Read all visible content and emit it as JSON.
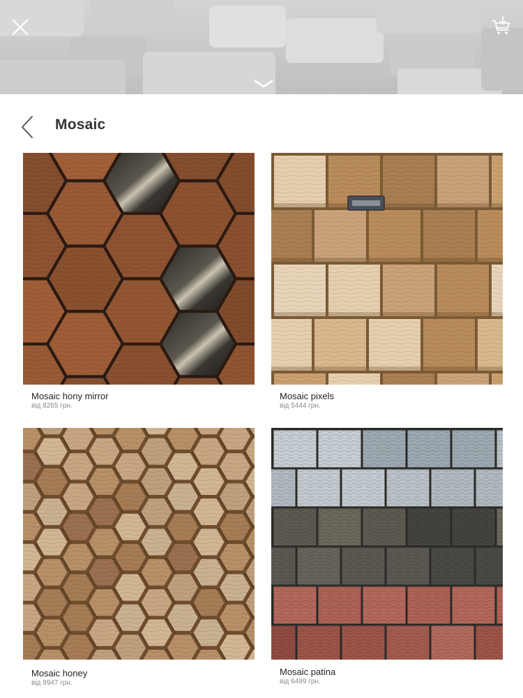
{
  "banner": {
    "close_icon": "close-icon",
    "cart_icon": "cart-download-icon",
    "collapse_icon": "chevron-down-icon"
  },
  "header": {
    "back_icon": "chevron-left-icon",
    "title": "Mosaic"
  },
  "products": [
    {
      "name": "Mosaic hony mirror",
      "price": "від 8265 грн.",
      "pattern": "hexagon-wood-mirror"
    },
    {
      "name": "Mosaic pixels",
      "price": "від 5444 грн.",
      "pattern": "square-wood-blocks"
    },
    {
      "name": "Mosaic honey",
      "price": "від 9947 грн.",
      "pattern": "hexagon-wood-light"
    },
    {
      "name": "Mosaic patina",
      "price": "від 6499 грн.",
      "pattern": "end-grain-tricolor"
    }
  ],
  "colors": {
    "banner_gray": "#c8c8c8",
    "walnut": "#8a5332",
    "light_oak": "#d9b88e",
    "ash_gray": "#a9b3ba",
    "dark_patina": "#4a4a44",
    "red_patina": "#a85a4f"
  }
}
